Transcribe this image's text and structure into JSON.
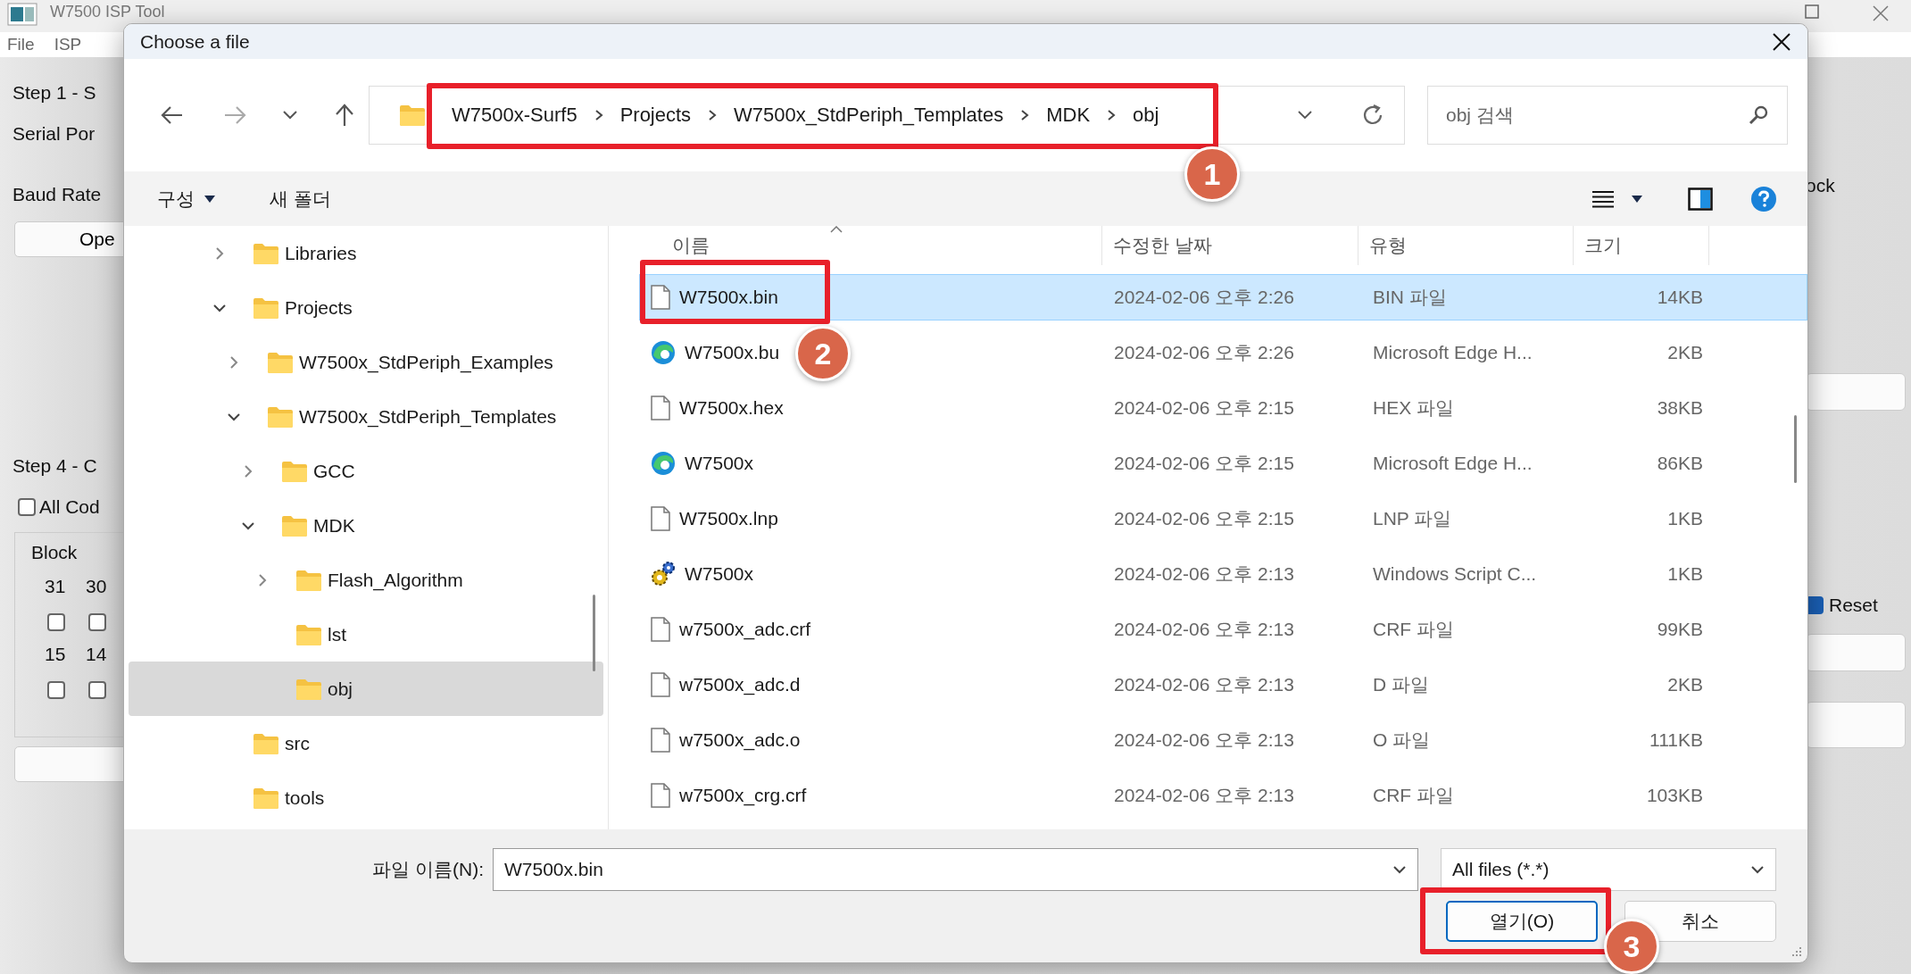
{
  "app": {
    "title": "W7500 ISP Tool",
    "menu": [
      "File",
      "ISP"
    ],
    "left_panel": {
      "step1": "Step 1 - S",
      "serial_port_label": "Serial Por",
      "baud_rate_label": "Baud Rate",
      "open_button": "Ope",
      "step4": "Step 4 - C",
      "all_code": {
        "label": "All Cod",
        "checked": false
      },
      "block_group": {
        "title": "Block",
        "bit_rows": [
          [
            {
              "label": "31",
              "checked": false
            },
            {
              "label": "30",
              "checked": false
            }
          ],
          [
            {
              "label": "15",
              "checked": false
            },
            {
              "label": "14",
              "checked": false
            }
          ]
        ]
      }
    },
    "right_panel": {
      "label": "ock",
      "reset": {
        "label": "Reset",
        "checked": true
      }
    }
  },
  "dialog": {
    "title": "Choose a file",
    "breadcrumbs": [
      "W7500x-Surf5",
      "Projects",
      "W7500x_StdPeriph_Templates",
      "MDK",
      "obj"
    ],
    "search": {
      "placeholder": "obj 검색"
    },
    "commands": [
      {
        "label": "구성",
        "kind": "menu"
      },
      {
        "label": "새 폴더",
        "kind": "button"
      }
    ],
    "nav_tree": [
      {
        "label": "Libraries",
        "expanded": false,
        "selected": false
      },
      {
        "label": "Projects",
        "expanded": true,
        "selected": false,
        "children": [
          {
            "label": "W7500x_StdPeriph_Examples",
            "expanded": false,
            "selected": false
          },
          {
            "label": "W7500x_StdPeriph_Templates",
            "expanded": true,
            "selected": false,
            "children": [
              {
                "label": "GCC",
                "expanded": false,
                "selected": false
              },
              {
                "label": "MDK",
                "expanded": true,
                "selected": false,
                "children": [
                  {
                    "label": "Flash_Algorithm",
                    "expanded": false,
                    "selected": false
                  },
                  {
                    "label": "lst",
                    "selected": false
                  },
                  {
                    "label": "obj",
                    "selected": true
                  }
                ]
              }
            ]
          }
        ]
      },
      {
        "label": "src",
        "selected": false
      },
      {
        "label": "tools",
        "selected": false
      }
    ],
    "columns": [
      "이름",
      "수정한 날짜",
      "유형",
      "크기"
    ],
    "files": [
      {
        "name": "W7500x.bin",
        "modified": "2024-02-06 오후 2:26",
        "type": "BIN 파일",
        "size": "14KB",
        "kind": "document",
        "selected": true
      },
      {
        "name": "W7500x.bu",
        "modified": "2024-02-06 오후 2:26",
        "type": "Microsoft Edge H...",
        "size": "2KB",
        "kind": "edge",
        "selected": false
      },
      {
        "name": "W7500x.hex",
        "modified": "2024-02-06 오후 2:15",
        "type": "HEX 파일",
        "size": "38KB",
        "kind": "document",
        "selected": false
      },
      {
        "name": "W7500x",
        "modified": "2024-02-06 오후 2:15",
        "type": "Microsoft Edge H...",
        "size": "86KB",
        "kind": "edge",
        "selected": false
      },
      {
        "name": "W7500x.lnp",
        "modified": "2024-02-06 오후 2:15",
        "type": "LNP 파일",
        "size": "1KB",
        "kind": "document",
        "selected": false
      },
      {
        "name": "W7500x",
        "modified": "2024-02-06 오후 2:13",
        "type": "Windows Script C...",
        "size": "1KB",
        "kind": "script",
        "selected": false
      },
      {
        "name": "w7500x_adc.crf",
        "modified": "2024-02-06 오후 2:13",
        "type": "CRF 파일",
        "size": "99KB",
        "kind": "document",
        "selected": false
      },
      {
        "name": "w7500x_adc.d",
        "modified": "2024-02-06 오후 2:13",
        "type": "D 파일",
        "size": "2KB",
        "kind": "document",
        "selected": false
      },
      {
        "name": "w7500x_adc.o",
        "modified": "2024-02-06 오후 2:13",
        "type": "O 파일",
        "size": "111KB",
        "kind": "document",
        "selected": false
      },
      {
        "name": "w7500x_crg.crf",
        "modified": "2024-02-06 오후 2:13",
        "type": "CRF 파일",
        "size": "103KB",
        "kind": "document",
        "selected": false
      }
    ],
    "file_name": {
      "label": "파일 이름(N):",
      "value": "W7500x.bin"
    },
    "file_type": "All files (*.*)",
    "buttons": [
      {
        "label": "열기(O)",
        "default": true
      },
      {
        "label": "취소",
        "default": false
      }
    ]
  },
  "annotations": [
    {
      "label": "1"
    },
    {
      "label": "2"
    },
    {
      "label": "3"
    }
  ]
}
